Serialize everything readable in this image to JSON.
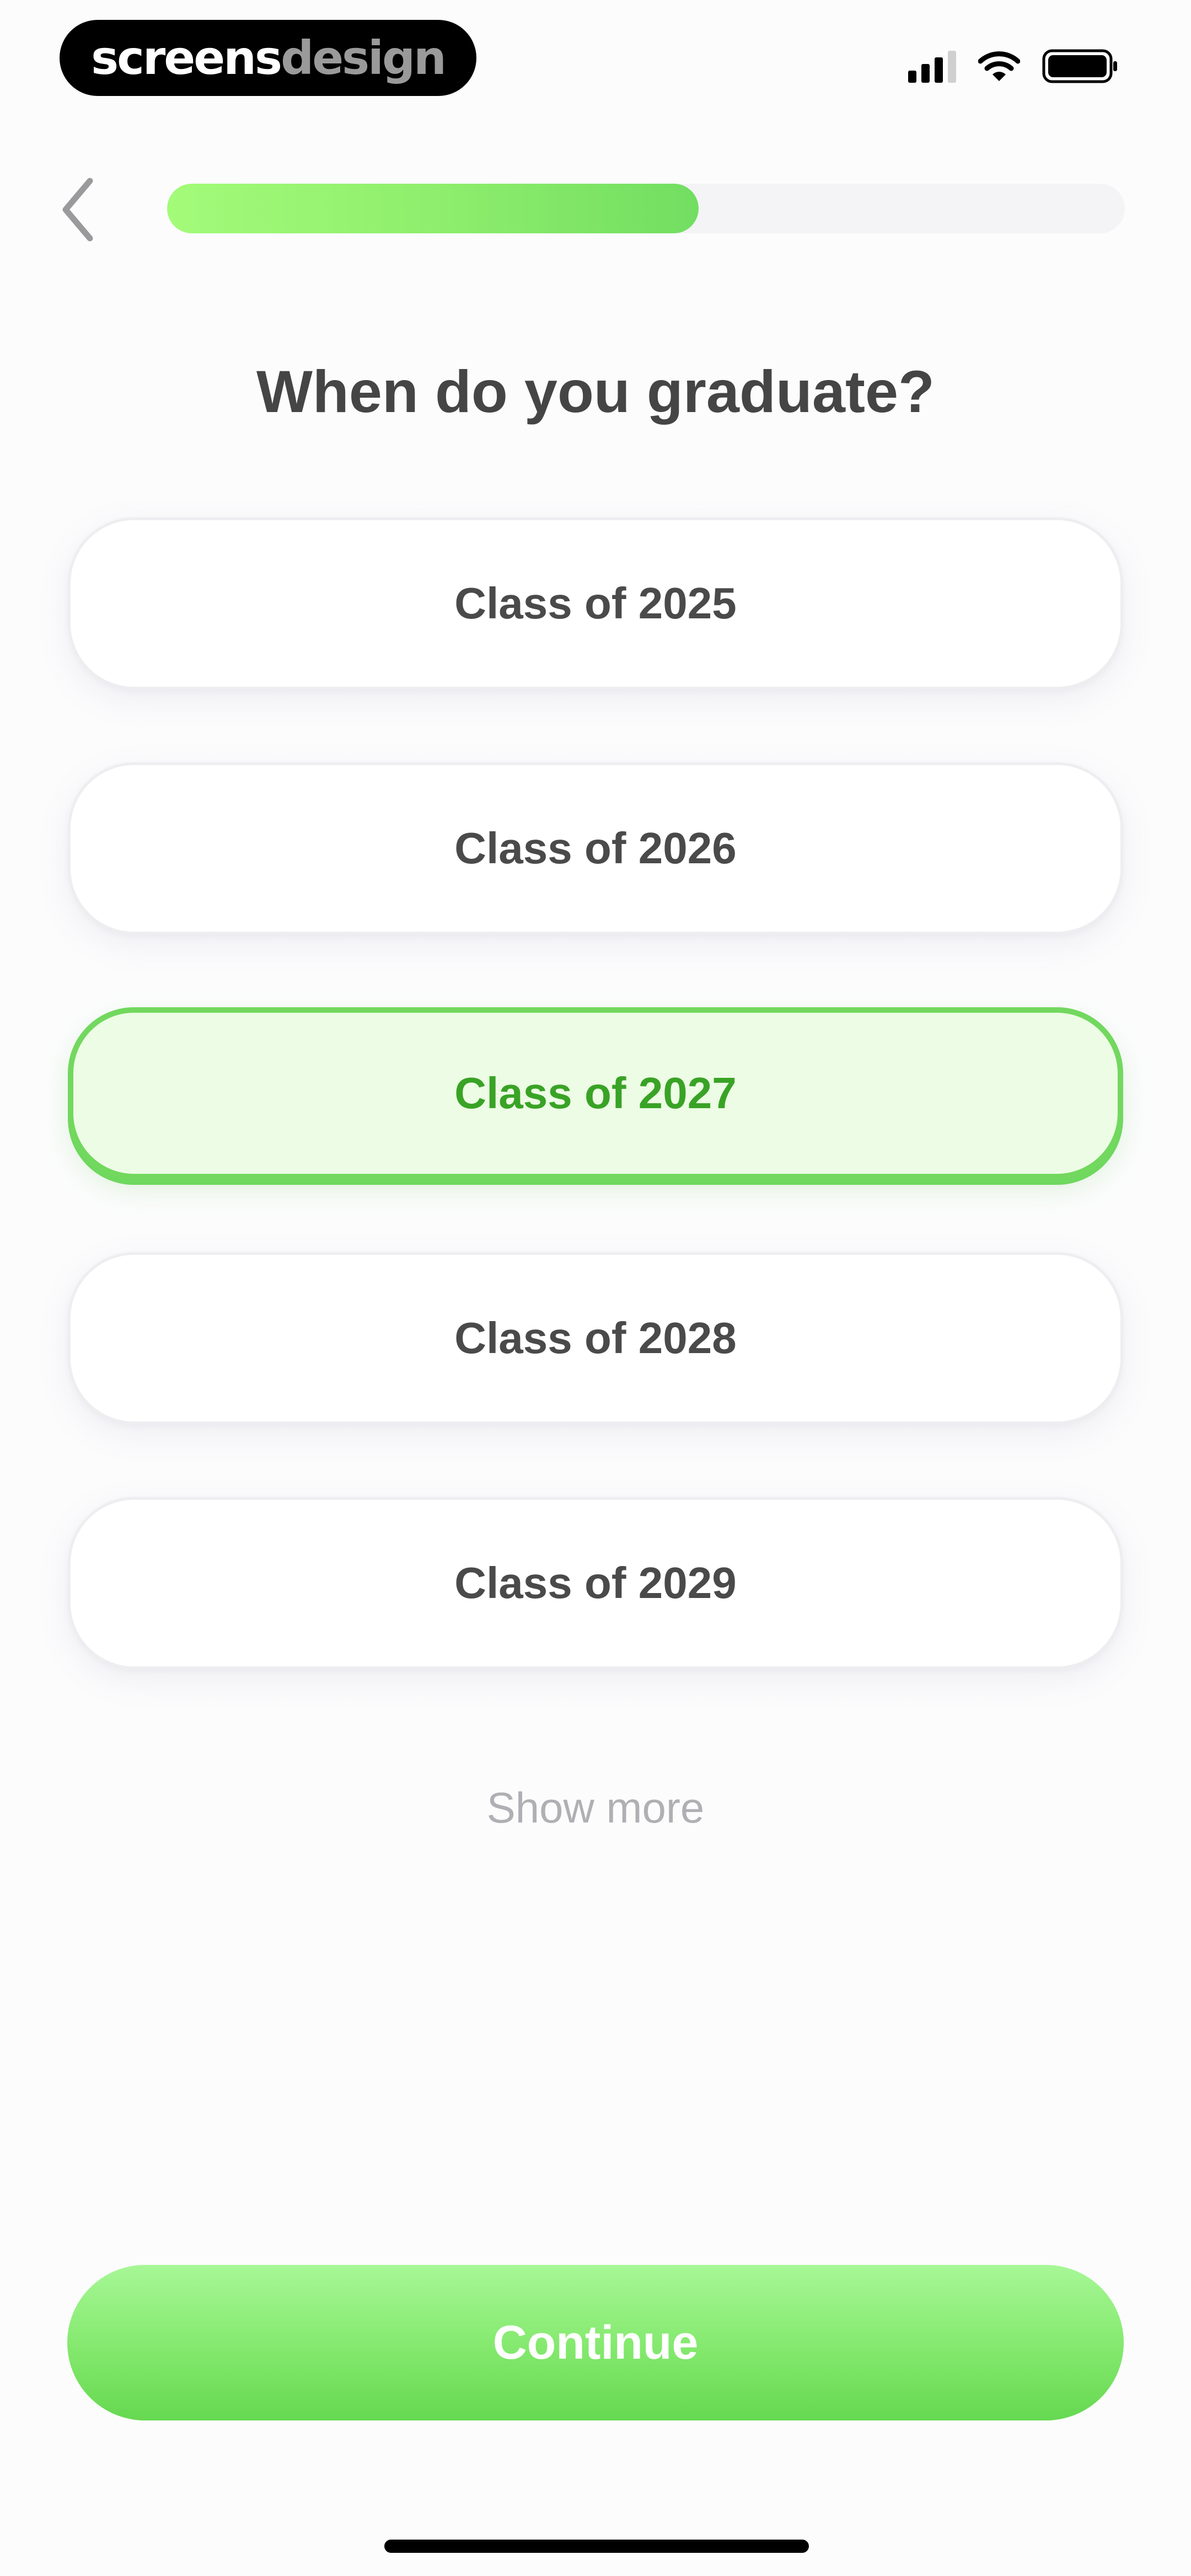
{
  "status_bar": {
    "brand_part1": "screens",
    "brand_part2": "design",
    "icons": [
      "cellular-signal-icon",
      "wifi-icon",
      "battery-icon"
    ]
  },
  "header": {
    "back_icon": "chevron-left-icon",
    "progress": 0.555
  },
  "question": {
    "title": "When do you graduate?"
  },
  "options": [
    {
      "label": "Class of 2025",
      "selected": false
    },
    {
      "label": "Class of 2026",
      "selected": false
    },
    {
      "label": "Class of 2027",
      "selected": true
    },
    {
      "label": "Class of 2028",
      "selected": false
    },
    {
      "label": "Class of 2029",
      "selected": false
    }
  ],
  "show_more_label": "Show more",
  "continue_label": "Continue",
  "colors": {
    "accent_green": "#72d85e",
    "selected_bg": "#edfce5",
    "selected_text": "#39a326",
    "title_text": "#454545",
    "muted_text": "#b0afb3"
  }
}
